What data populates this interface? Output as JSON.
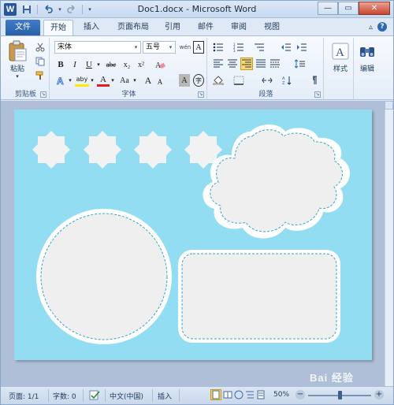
{
  "window": {
    "title": "Doc1.docx - Microsoft Word",
    "app_icon_letter": "W",
    "controls": {
      "minimize": "—",
      "maximize": "▭",
      "close": "✕"
    }
  },
  "quick_access": {
    "save_icon": "save-icon",
    "undo_icon": "undo-icon",
    "redo_icon": "redo-icon",
    "customize": "▾"
  },
  "tabs": {
    "file": "文件",
    "home": "开始",
    "insert": "插入",
    "page_layout": "页面布局",
    "references": "引用",
    "mailings": "邮件",
    "review": "审阅",
    "view": "视图",
    "minimize_ribbon": "▵",
    "help": "?"
  },
  "ribbon": {
    "clipboard": {
      "label": "剪贴板",
      "paste": "粘贴",
      "paste_arrow": "▾"
    },
    "font": {
      "label": "字体",
      "font_name": "宋体",
      "font_size": "五号",
      "bold": "B",
      "italic": "I",
      "underline": "U",
      "strikethrough": "abc",
      "subscript": "x₂",
      "superscript": "x²",
      "grow": "A",
      "shrink": "A",
      "change_case": "Aa",
      "clear": "Aa",
      "phonetic": "wén",
      "char_border": "A",
      "char_shading": "A",
      "enclosed": "字",
      "highlight": "aby",
      "font_color": "A"
    },
    "paragraph": {
      "label": "段落"
    },
    "styles": {
      "label": "样式"
    },
    "editing": {
      "label": "编辑"
    }
  },
  "colors": {
    "page_background": "#92ddf2",
    "shape_fill": "#f0f0f0",
    "shape_outline": "#ffffff",
    "dashed_stitch": "#3aa6c4",
    "highlight_yellow": "#ffea00",
    "font_color_red": "#e21e1e",
    "align_right_active": "#ffd86b"
  },
  "document": {
    "shapes": [
      "star-8-point",
      "star-8-point",
      "star-8-point",
      "star-8-point",
      "cloud",
      "circle",
      "rounded-rectangle"
    ]
  },
  "statusbar": {
    "page": "页面: 1/1",
    "words": "字数: 0",
    "language": "中文(中国)",
    "mode": "插入",
    "zoom": "50%",
    "zoom_minus": "−",
    "zoom_plus": "+",
    "zoom_fraction": 0.5
  },
  "watermark": "Bai 经验"
}
